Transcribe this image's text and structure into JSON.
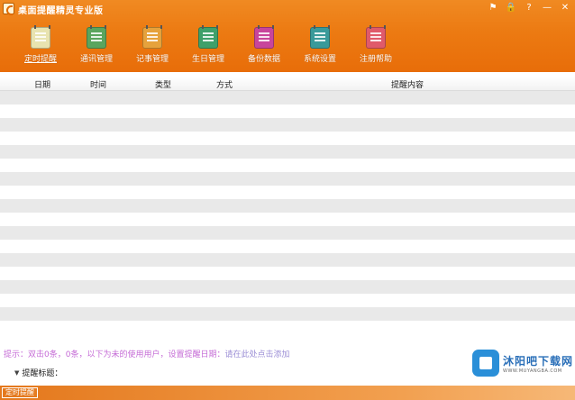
{
  "window": {
    "title": "桌面提醒精灵专业版",
    "controls": [
      "⚑",
      "🔒",
      "?",
      "—",
      "✕"
    ]
  },
  "toolbar": {
    "items": [
      {
        "label": "定时提醒",
        "color": "#e8e3b0",
        "name": "timed-reminder",
        "underline": true
      },
      {
        "label": "通讯管理",
        "color": "#5aa55e",
        "name": "contacts",
        "underline": false
      },
      {
        "label": "记事管理",
        "color": "#e6a23c",
        "name": "notes",
        "underline": false
      },
      {
        "label": "生日管理",
        "color": "#3fa06a",
        "name": "birthday",
        "underline": false
      },
      {
        "label": "备份数据",
        "color": "#c8459c",
        "name": "backup",
        "underline": false
      },
      {
        "label": "系统设置",
        "color": "#3a9a9a",
        "name": "settings",
        "underline": false
      },
      {
        "label": "注册帮助",
        "color": "#e05a6a",
        "name": "register-help",
        "underline": false
      }
    ]
  },
  "table": {
    "columns": [
      "日期",
      "时间",
      "类型",
      "方式",
      "提醒内容"
    ],
    "row_count": 18
  },
  "tip": {
    "prefix": "提示：",
    "part1": "双击0条，0条，以下为未的使用用户，",
    "part2": "设置提醒日期：",
    "part3": "请在此处点击添加"
  },
  "reminder": {
    "label": "提醒标题："
  },
  "statusbar": {
    "button": "定时提醒"
  },
  "watermark": {
    "name": "沐阳吧下载网",
    "url": "WWW.MUYANGBA.COM"
  }
}
